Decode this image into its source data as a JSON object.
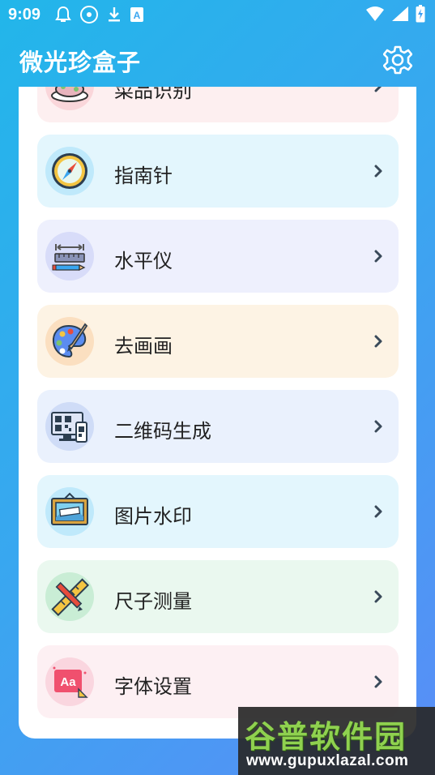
{
  "status_bar": {
    "time": "9:09",
    "left_icons": [
      "notification-bell-icon",
      "media-disc-icon",
      "download-icon",
      "translate-icon"
    ],
    "right_icons": [
      "wifi-icon",
      "signal-icon",
      "battery-charging-icon"
    ]
  },
  "app": {
    "title": "微光珍盒子",
    "settings_icon": "gear-icon"
  },
  "colors": {
    "header_gradient_start": "#22b6ea",
    "header_gradient_end": "#5a8df7",
    "chevron": "#3a4a5a",
    "watermark_green": "#8fd14f"
  },
  "items": [
    {
      "label": "菜品识别",
      "icon": "dish-icon",
      "bg": "#fdeff0",
      "icon_bg": "#fad6da"
    },
    {
      "label": "指南针",
      "icon": "compass-icon",
      "bg": "#e3f6fd",
      "icon_bg": "#bfe9fb"
    },
    {
      "label": "水平仪",
      "icon": "level-ruler-icon",
      "bg": "#eef0fd",
      "icon_bg": "#d8dcf9"
    },
    {
      "label": "去画画",
      "icon": "palette-icon",
      "bg": "#fdf3e4",
      "icon_bg": "#fbdfc0"
    },
    {
      "label": "二维码生成",
      "icon": "qr-computer-icon",
      "bg": "#eaf1fd",
      "icon_bg": "#cfdcf7"
    },
    {
      "label": "图片水印",
      "icon": "framed-picture-icon",
      "bg": "#e3f6fd",
      "icon_bg": "#bfe9fb"
    },
    {
      "label": "尺子测量",
      "icon": "ruler-pencil-icon",
      "bg": "#eaf8ef",
      "icon_bg": "#c9edd5"
    },
    {
      "label": "字体设置",
      "icon": "font-aa-icon",
      "bg": "#fdf0f3",
      "icon_bg": "#fad6df"
    }
  ],
  "watermark": {
    "title": "谷普软件园",
    "url": "www.gupuxlazal.com"
  }
}
